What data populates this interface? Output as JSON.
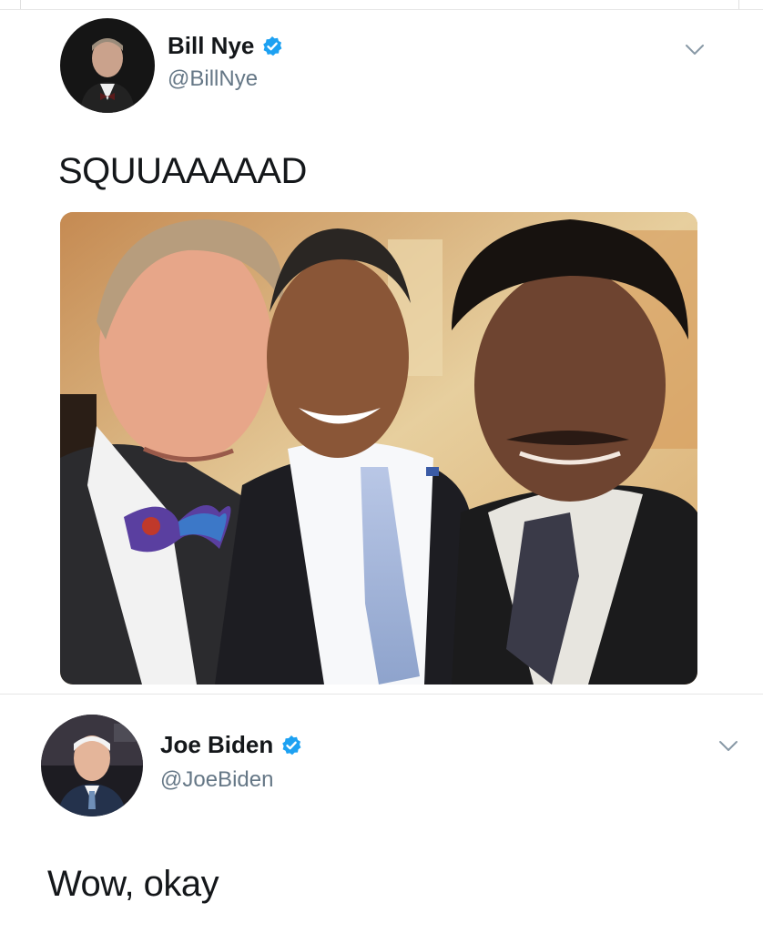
{
  "tweets": [
    {
      "author": {
        "display_name": "Bill Nye",
        "handle": "@BillNye",
        "verified": true
      },
      "text": "SQUUAAAAAD",
      "has_photo": true,
      "avatar_icon": "user-avatar",
      "menu_icon": "chevron-down-icon"
    },
    {
      "author": {
        "display_name": "Joe Biden",
        "handle": "@JoeBiden",
        "verified": true
      },
      "text": "Wow, okay",
      "has_photo": false,
      "avatar_icon": "user-avatar",
      "menu_icon": "chevron-down-icon"
    }
  ],
  "colors": {
    "verified_blue": "#1da1f2",
    "handle_gray": "#657786",
    "text_dark": "#14171a",
    "divider": "#e6e6e6"
  }
}
